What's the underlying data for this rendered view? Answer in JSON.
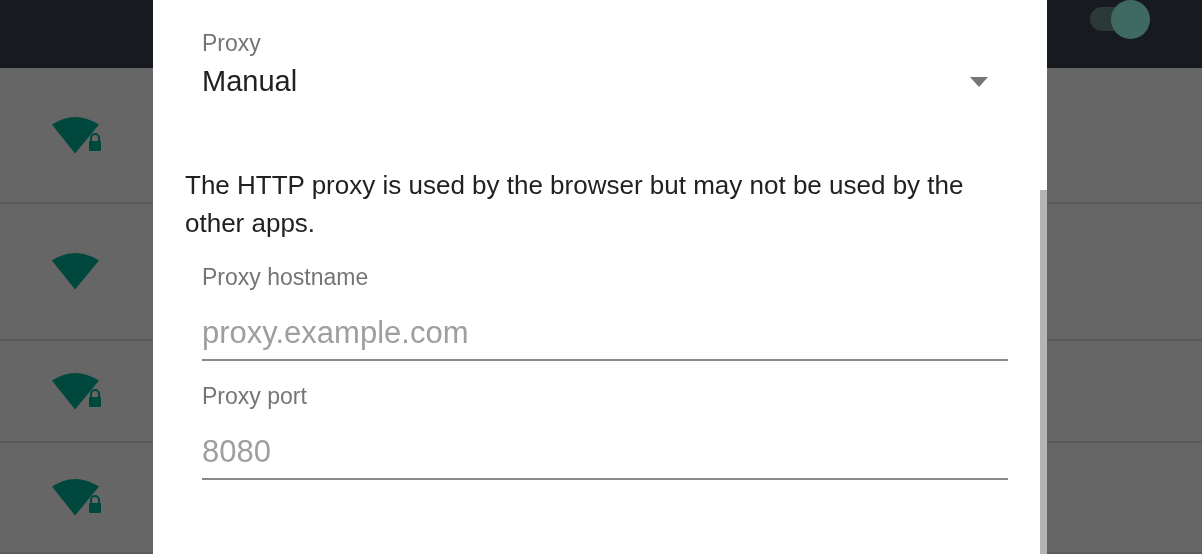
{
  "background": {
    "wifi_toggle": {
      "on": true
    },
    "networks": [
      {
        "locked": true
      },
      {
        "locked": false
      },
      {
        "locked": true
      },
      {
        "locked": true
      }
    ]
  },
  "dialog": {
    "proxy": {
      "label": "Proxy",
      "value": "Manual"
    },
    "note": "The HTTP proxy is used by the browser but may not be used by the other apps.",
    "fields": [
      {
        "label": "Proxy hostname",
        "placeholder": "proxy.example.com"
      },
      {
        "label": "Proxy port",
        "placeholder": "8080"
      }
    ]
  }
}
